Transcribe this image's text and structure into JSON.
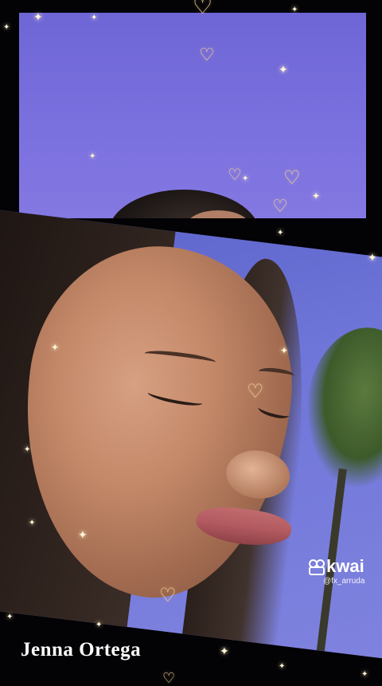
{
  "caption": "Jenna Ortega",
  "watermark": {
    "brand": "kwai",
    "handle": "@fx_arruda",
    "logo_icon": "kwai-logo-icon"
  },
  "colors": {
    "background": "#030204",
    "sky": "#7a70de",
    "heart": "#f0d49a",
    "sparkle": "#fff6d8"
  }
}
